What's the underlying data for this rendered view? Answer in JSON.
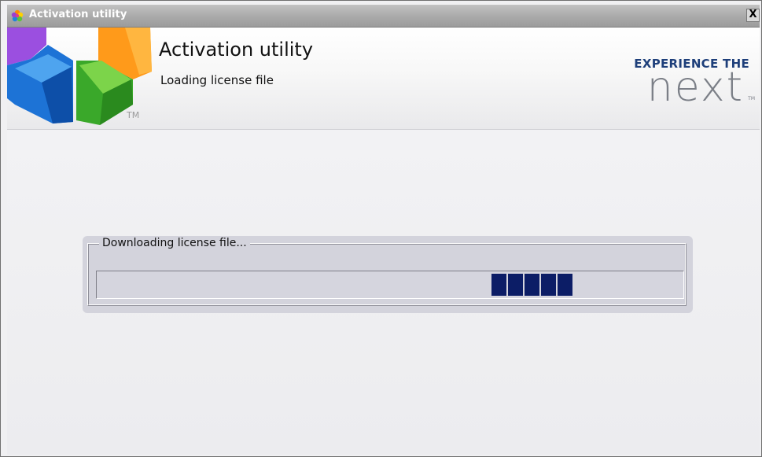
{
  "window": {
    "title": "Activation utility",
    "close_label": "X"
  },
  "header": {
    "title": "Activation utility",
    "subtitle": "Loading license file",
    "logo_tm": "TM",
    "brand": {
      "tagline": "EXPERIENCE THE",
      "wordmark": "next",
      "wordmark_tm": "TM"
    }
  },
  "progress": {
    "group_label": "Downloading license file...",
    "style": "marquee",
    "block_count": 5,
    "block_color": "#0c1d66"
  },
  "colors": {
    "brand_blue": "#1e3f7a",
    "brand_gray": "#7b7f87",
    "panel_bg": "#d3d3dc"
  },
  "icons": {
    "titlebar": "app-flower-icon",
    "logo": "hexagon-logo-icon"
  }
}
